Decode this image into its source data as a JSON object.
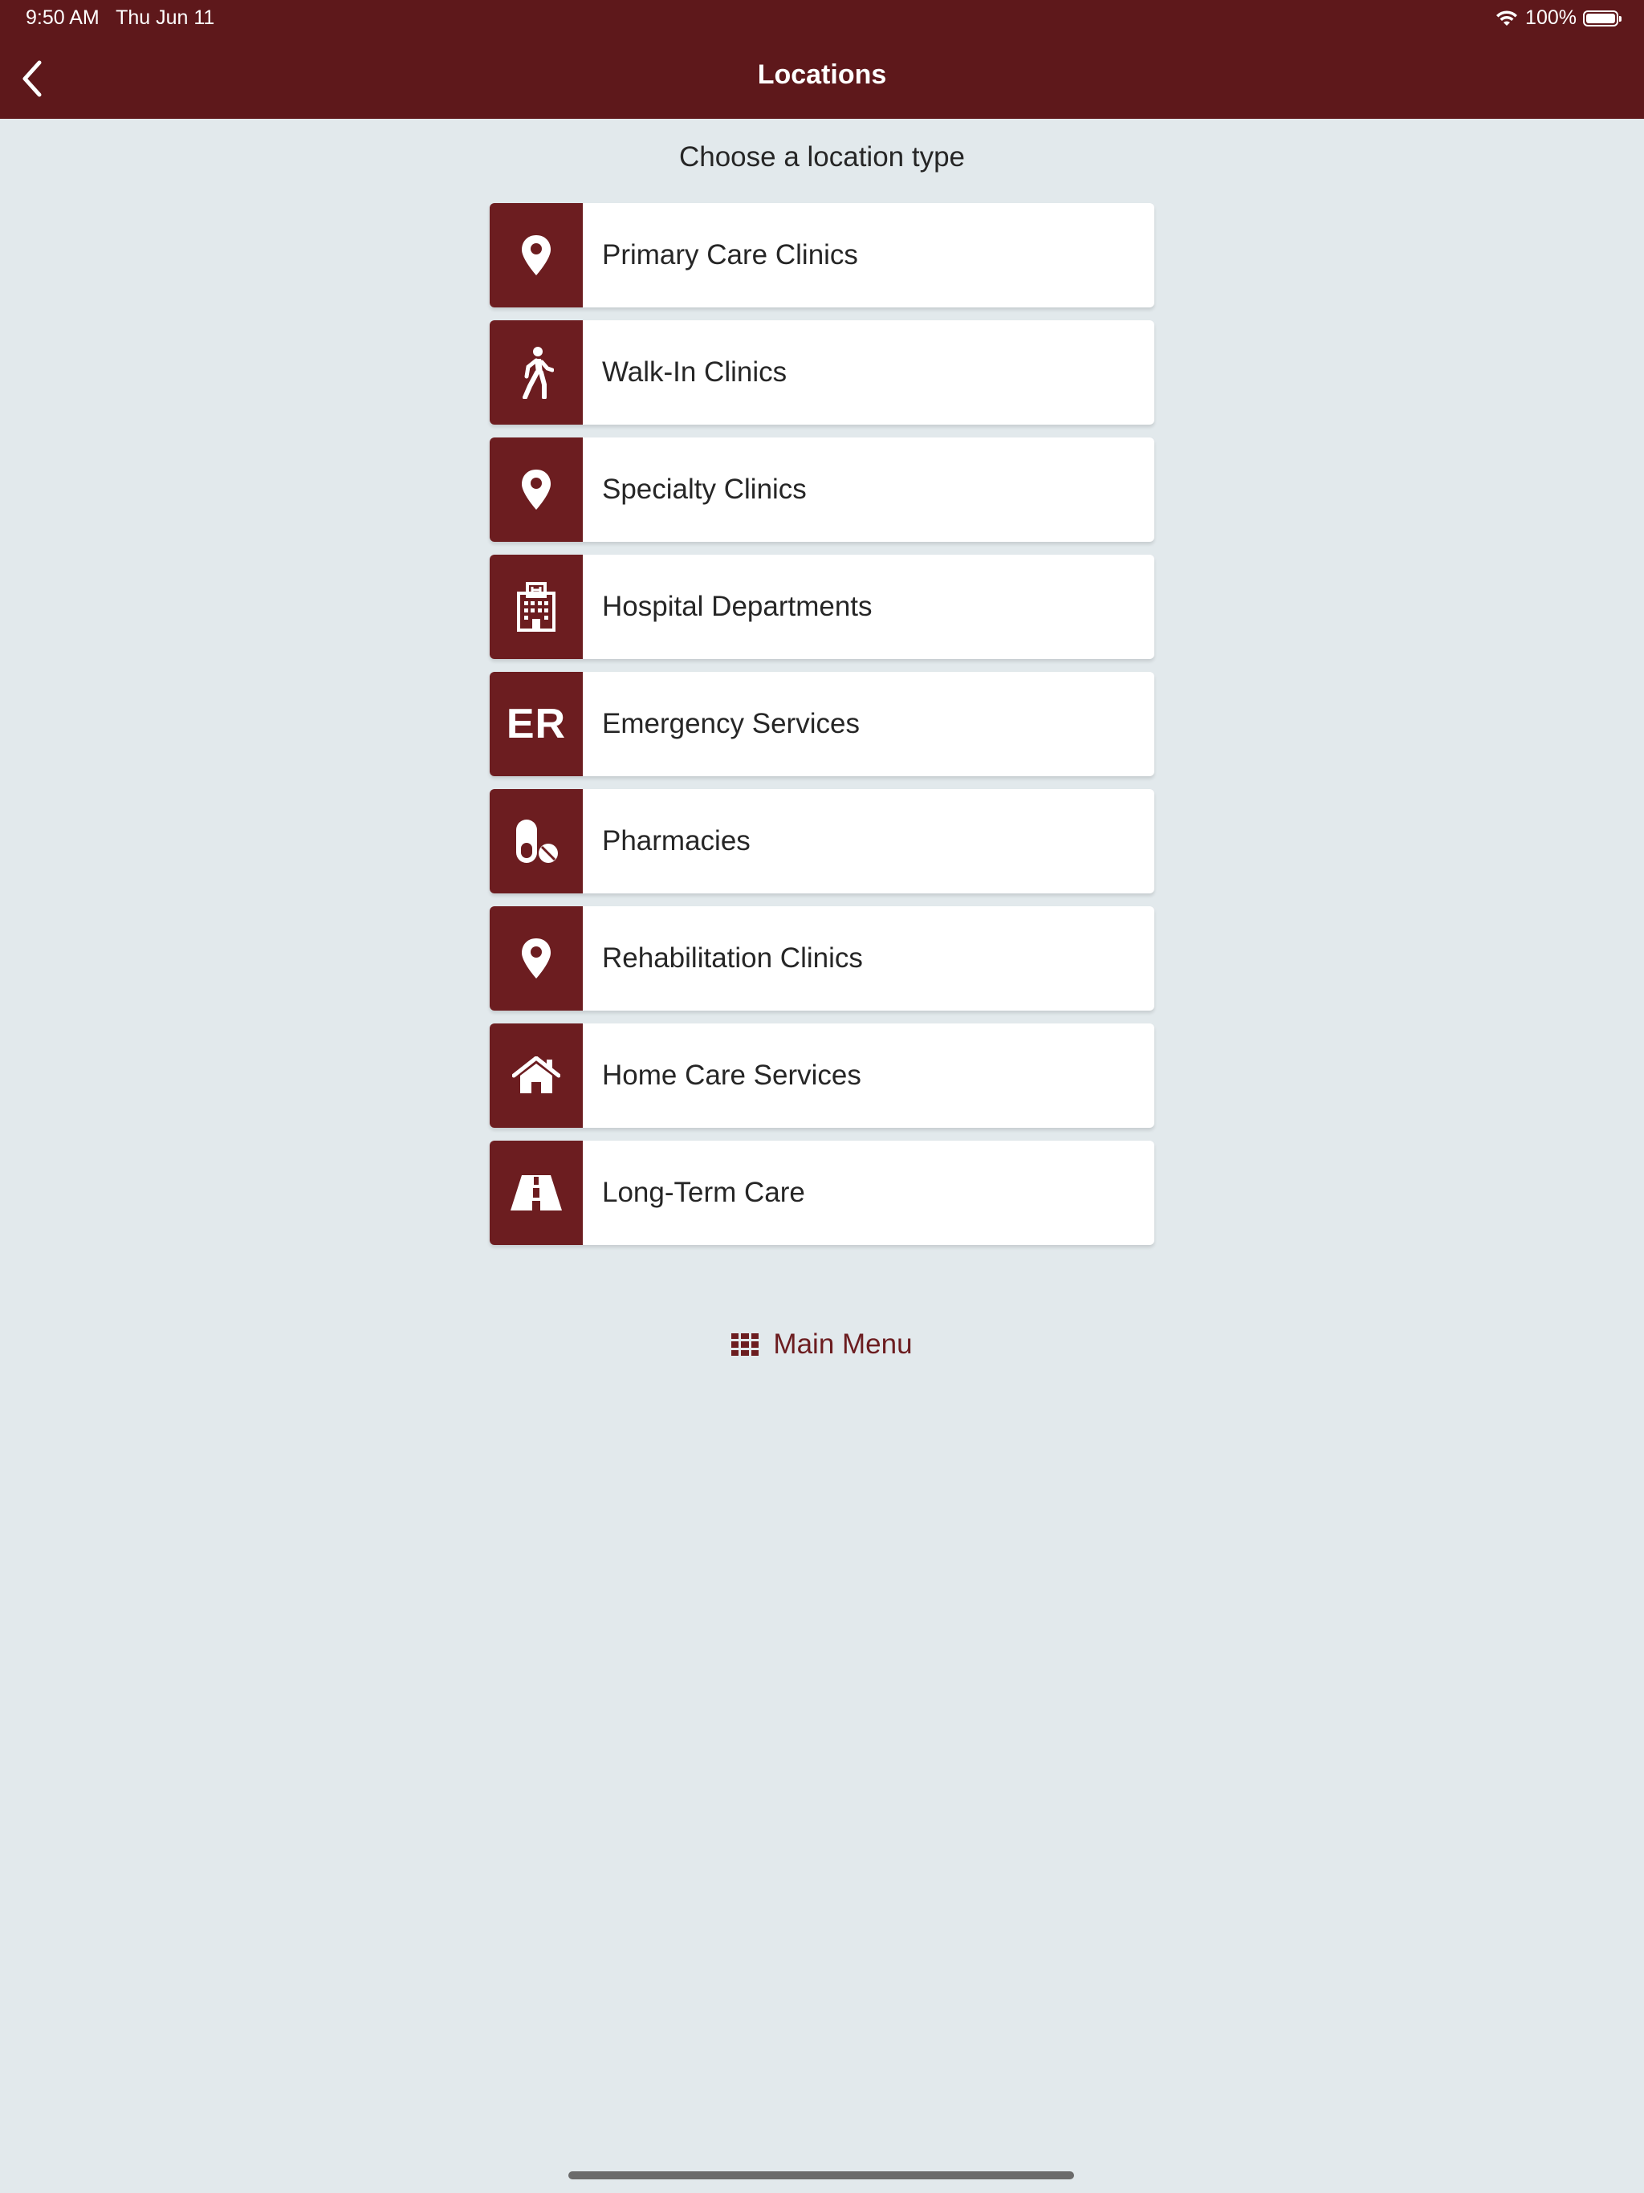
{
  "status_bar": {
    "time": "9:50 AM   Thu Jun 11",
    "battery_percent": "100%"
  },
  "header": {
    "title": "Locations"
  },
  "prompt": "Choose a location type",
  "location_types": [
    {
      "label": "Primary Care Clinics",
      "icon": "map-pin-icon"
    },
    {
      "label": "Walk-In Clinics",
      "icon": "walking-person-icon"
    },
    {
      "label": "Specialty Clinics",
      "icon": "map-pin-icon"
    },
    {
      "label": "Hospital Departments",
      "icon": "hospital-building-icon"
    },
    {
      "label": "Emergency Services",
      "icon": "er-icon",
      "icon_text": "ER"
    },
    {
      "label": "Pharmacies",
      "icon": "pills-icon"
    },
    {
      "label": "Rehabilitation Clinics",
      "icon": "map-pin-icon"
    },
    {
      "label": "Home Care Services",
      "icon": "house-icon"
    },
    {
      "label": "Long-Term Care",
      "icon": "road-icon"
    }
  ],
  "footer": {
    "main_menu_label": "Main Menu"
  },
  "colors": {
    "header_bg": "#5e181b",
    "accent": "#6c1d20",
    "page_bg": "#e2e9ec"
  }
}
